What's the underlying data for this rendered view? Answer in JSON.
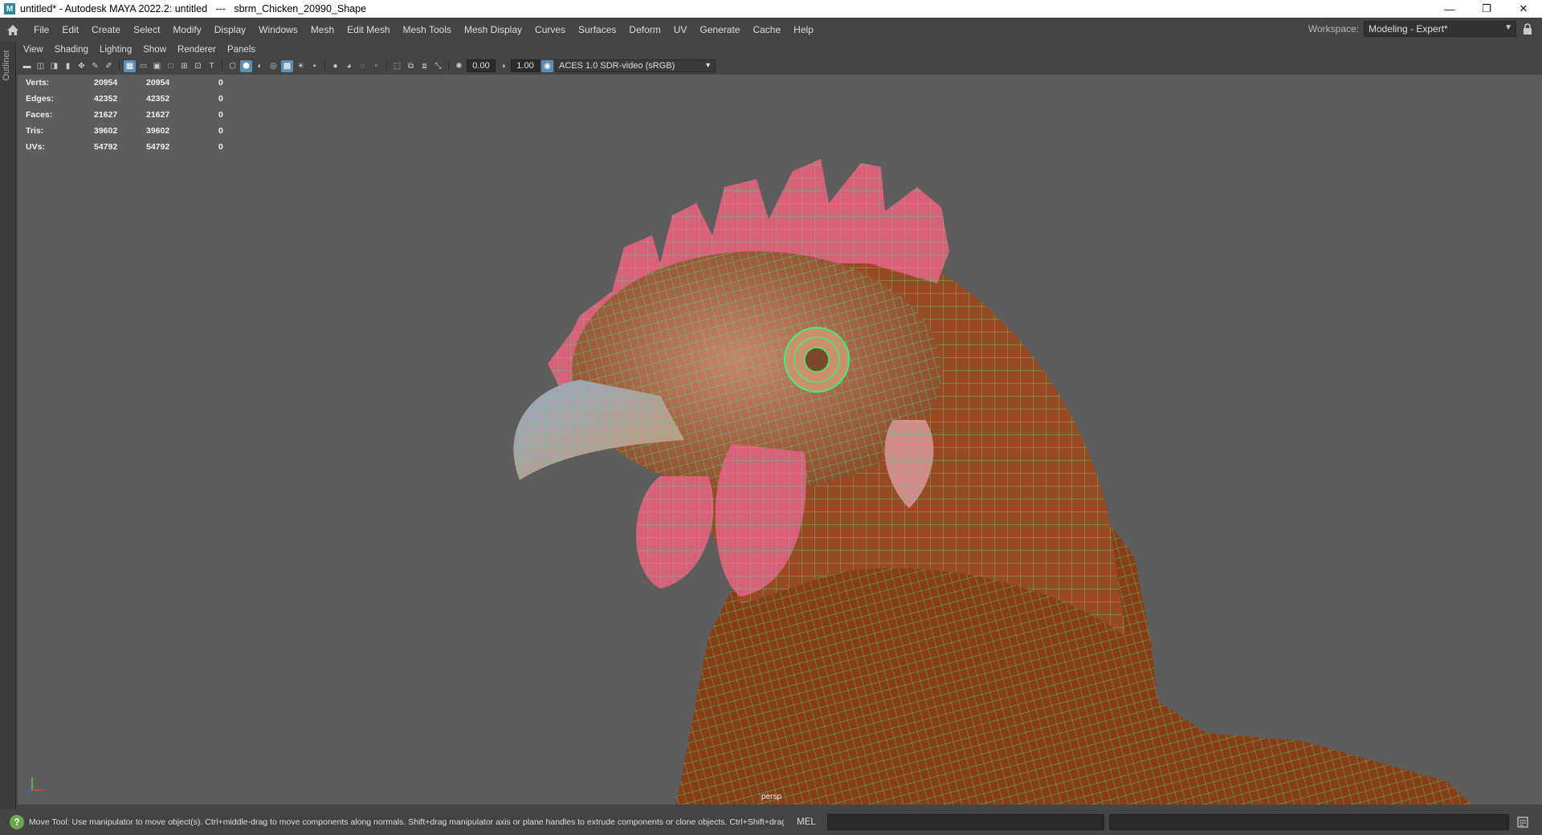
{
  "window": {
    "title": "untitled* - Autodesk MAYA 2022.2: untitled   ---   sbrm_Chicken_20990_Shape",
    "app_icon_letter": "M",
    "controls": {
      "minimize": "—",
      "restore": "❐",
      "close": "✕"
    }
  },
  "menubar": {
    "items": [
      "File",
      "Edit",
      "Create",
      "Select",
      "Modify",
      "Display",
      "Windows",
      "Mesh",
      "Edit Mesh",
      "Mesh Tools",
      "Mesh Display",
      "Curves",
      "Surfaces",
      "Deform",
      "UV",
      "Generate",
      "Cache",
      "Help"
    ],
    "workspace_label": "Workspace:",
    "workspace_value": "Modeling - Expert*"
  },
  "outliner": {
    "label": "Outliner"
  },
  "panel_menu": {
    "items": [
      "View",
      "Shading",
      "Lighting",
      "Show",
      "Renderer",
      "Panels"
    ]
  },
  "panel_toolbar": {
    "exposure_value": "0.00",
    "gamma_value": "1.00",
    "color_space": "ACES 1.0 SDR-video (sRGB)"
  },
  "hud": {
    "rows": [
      {
        "label": "Verts:",
        "v1": "20954",
        "v2": "20954",
        "v3": "0"
      },
      {
        "label": "Edges:",
        "v1": "42352",
        "v2": "42352",
        "v3": "0"
      },
      {
        "label": "Faces:",
        "v1": "21627",
        "v2": "21627",
        "v3": "0"
      },
      {
        "label": "Tris:",
        "v1": "39602",
        "v2": "39602",
        "v3": "0"
      },
      {
        "label": "UVs:",
        "v1": "54792",
        "v2": "54792",
        "v3": "0"
      }
    ]
  },
  "viewport": {
    "camera_label": "persp"
  },
  "colors": {
    "wireframe": "#3df07a",
    "comb": "#d9607a",
    "feathers": "#8a3e18",
    "viewport_bg": "#5d5d5d"
  },
  "status": {
    "help_text": "Move Tool: Use manipulator to move object(s). Ctrl+middle-drag to move components along normals. Shift+drag manipulator axis or plane handles to extrude components or clone objects. Ctrl+Shift+drag to con:",
    "mel_label": "MEL"
  }
}
